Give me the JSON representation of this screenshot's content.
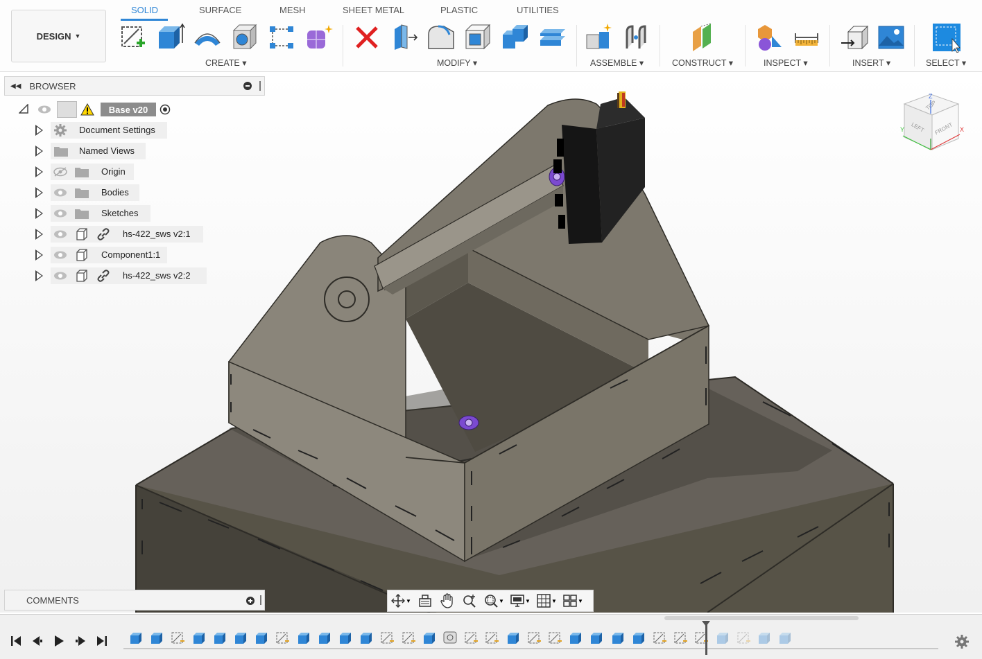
{
  "workspace": {
    "label": "DESIGN"
  },
  "tabs": [
    {
      "label": "SOLID",
      "active": true
    },
    {
      "label": "SURFACE"
    },
    {
      "label": "MESH"
    },
    {
      "label": "SHEET METAL"
    },
    {
      "label": "PLASTIC"
    },
    {
      "label": "UTILITIES"
    }
  ],
  "groups": {
    "create": "CREATE",
    "modify": "MODIFY",
    "assemble": "ASSEMBLE",
    "construct": "CONSTRUCT",
    "inspect": "INSPECT",
    "insert": "INSERT",
    "select": "SELECT"
  },
  "browser": {
    "title": "BROWSER",
    "root": {
      "label": "Base v20",
      "warning": true
    },
    "items": [
      {
        "label": "Document Settings",
        "icon": "gear-icon"
      },
      {
        "label": "Named Views",
        "icon": "folder-icon"
      },
      {
        "label": "Origin",
        "icon": "folder-icon",
        "visible": false
      },
      {
        "label": "Bodies",
        "icon": "folder-icon",
        "visible": true
      },
      {
        "label": "Sketches",
        "icon": "folder-icon",
        "visible": true
      },
      {
        "label": "hs-422_sws v2:1",
        "icon": "component-icon",
        "visible": true,
        "linked": true
      },
      {
        "label": "Component1:1",
        "icon": "component-icon",
        "visible": true,
        "linked": false
      },
      {
        "label": "hs-422_sws v2:2",
        "icon": "component-icon",
        "visible": true,
        "linked": true
      }
    ]
  },
  "comments": {
    "title": "COMMENTS"
  },
  "viewcube": {
    "top": "TOP",
    "left": "LEFT",
    "front": "FRONT",
    "axis_x": "X",
    "axis_y": "Y",
    "axis_z": "Z"
  },
  "colors": {
    "accent": "#2f86d6",
    "model": "#6b665a",
    "model_dark": "#4a463d",
    "highlight": "#8a55d8"
  }
}
